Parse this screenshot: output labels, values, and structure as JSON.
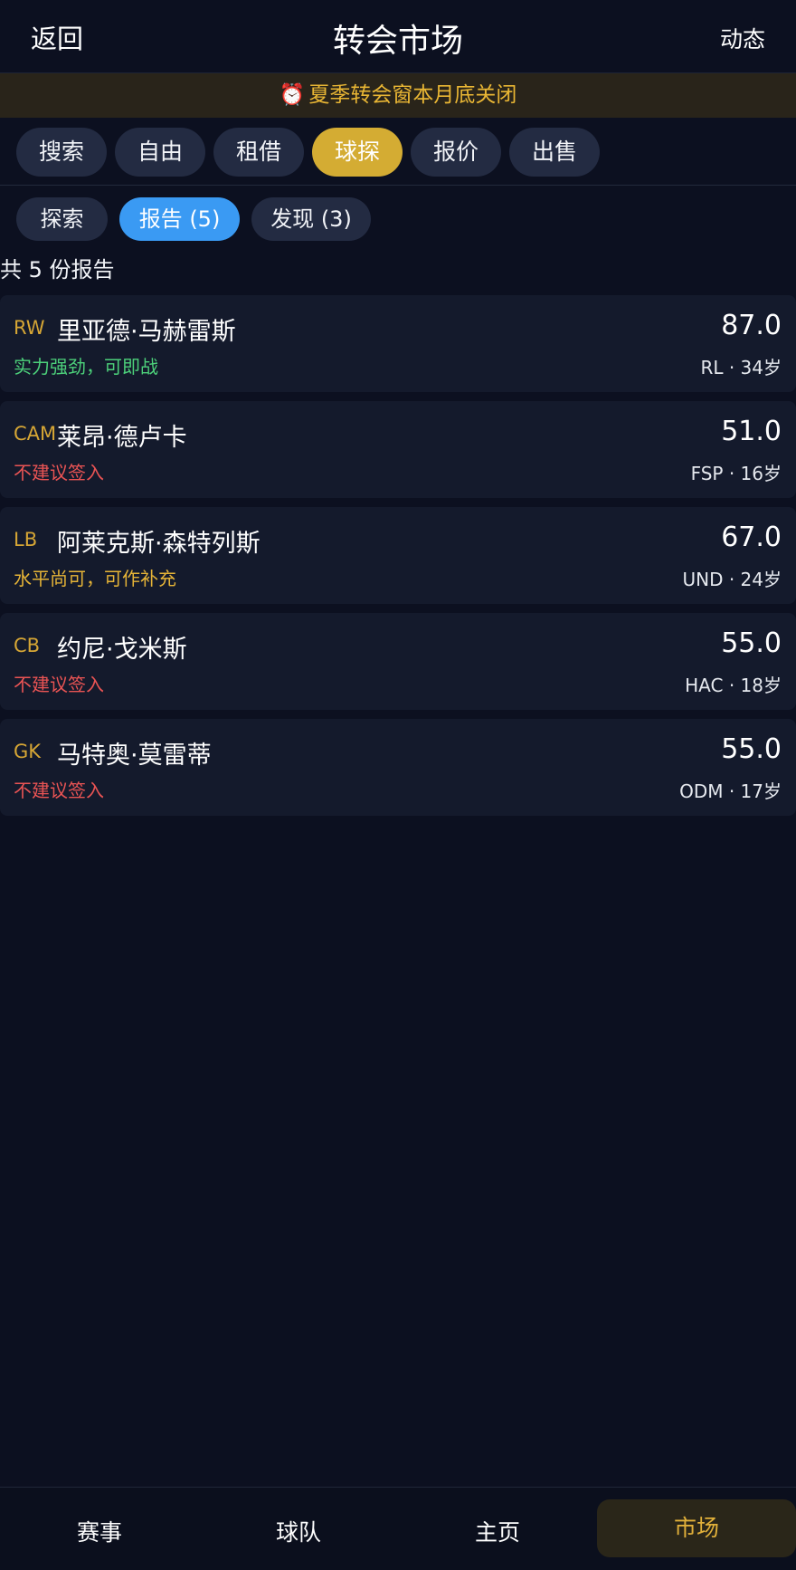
{
  "header": {
    "back": "返回",
    "title": "转会市场",
    "feed": "动态"
  },
  "banner": {
    "icon": "⏰",
    "text": "夏季转会窗本月底关闭"
  },
  "main_tabs": [
    {
      "label": "搜索"
    },
    {
      "label": "自由"
    },
    {
      "label": "租借"
    },
    {
      "label": "球探",
      "active": true
    },
    {
      "label": "报价"
    },
    {
      "label": "出售"
    }
  ],
  "sub_tabs": [
    {
      "label": "探索"
    },
    {
      "label": "报告 (5)",
      "active": true
    },
    {
      "label": "发现 (3)"
    }
  ],
  "report_count": "共 5 份报告",
  "reports": [
    {
      "pos": "RW",
      "name": "里亚德·马赫雷斯",
      "verdict": "实力强劲，可即战",
      "rating": "87.0",
      "meta": "RL · 34岁"
    },
    {
      "pos": "CAM",
      "name": "莱昂·德卢卡",
      "verdict": "不建议签入",
      "rating": "51.0",
      "meta": "FSP · 16岁"
    },
    {
      "pos": "LB",
      "name": "阿莱克斯·森特列斯",
      "verdict": "水平尚可，可作补充",
      "rating": "67.0",
      "meta": "UND · 24岁"
    },
    {
      "pos": "CB",
      "name": "约尼·戈米斯",
      "verdict": "不建议签入",
      "rating": "55.0",
      "meta": "HAC · 18岁"
    },
    {
      "pos": "GK",
      "name": "马特奥·莫雷蒂",
      "verdict": "不建议签入",
      "rating": "55.0",
      "meta": "ODM · 17岁"
    }
  ],
  "bottom_nav": [
    {
      "label": "赛事"
    },
    {
      "label": "球队"
    },
    {
      "label": "主页"
    },
    {
      "label": "市场",
      "active": true
    }
  ],
  "colors": {
    "background": "#0c1020",
    "accent_gold": "#d4ac33",
    "accent_blue": "#3a9af3",
    "verdict_good": "#4cd07a",
    "verdict_mid": "#e6b437",
    "verdict_bad": "#ea5454"
  }
}
